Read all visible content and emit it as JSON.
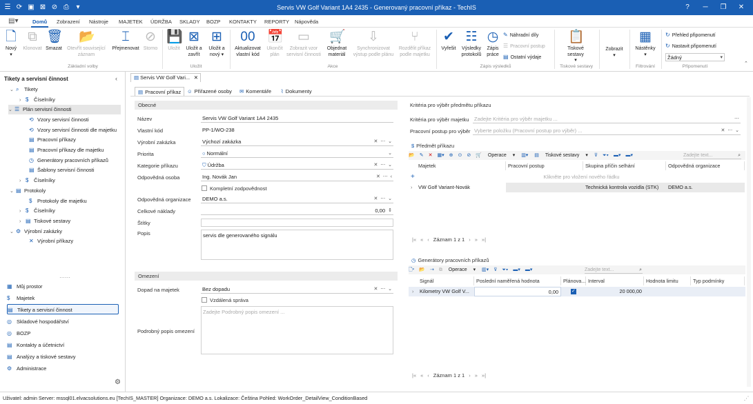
{
  "window": {
    "title": "Servis VW Golf Variant 1A4 2435 - Generovaný pracovní příkaz - TechIS"
  },
  "menu": [
    "Domů",
    "Zobrazení",
    "Nástroje",
    "MAJETEK",
    "ÚDRŽBA",
    "SKLADY",
    "BOZP",
    "KONTAKTY",
    "REPORTY",
    "Nápověda"
  ],
  "ribbon": {
    "new": "Nový",
    "clone": "Klonovat",
    "delete": "Smazat",
    "open_related": "Otevřít související záznam",
    "rename": "Přejmenovat",
    "cancel": "Storno",
    "group_basic": "Základní volby",
    "save": "Uložit",
    "save_close": "Uložit a zavřít",
    "save_new": "Uložit a nový",
    "group_save": "Uložit",
    "update_code": "Aktualizovat vlastní kód",
    "finish_plan": "Ukončit plán",
    "show_template": "Zobrazit vzor servisní činnosti",
    "order_material": "Objednat materiál",
    "sync_output": "Synchronizovat výstup podle plánu",
    "split_order": "Rozdělit příkaz podle majetku",
    "group_actions": "Akce",
    "resolve": "Vyřešit",
    "results": "Výsledky protokolů",
    "record_work": "Zápis práce",
    "spare_parts": "Náhradní díly",
    "work_postup": "Pracovní postup",
    "other_costs": "Ostatní výdaje",
    "group_results": "Zápis výsledků",
    "print_reports": "Tiskové sestavy",
    "group_print": "Tiskové sestavy",
    "show": "Zobrazit",
    "dashboards": "Nástěnky",
    "group_filter": "Filtrování",
    "reminder_overview": "Přehled připomenutí",
    "set_reminder": "Nastavit připomenutí",
    "reminder_value": "Žádný",
    "group_reminders": "Připomenutí"
  },
  "sidebar": {
    "title": "Tikety a servisní činnost",
    "tree": [
      {
        "label": "Tikety",
        "icon": "search-icon"
      },
      {
        "label": "Číselníky",
        "icon": "dollar-icon"
      },
      {
        "label": "Plán servisní činnosti",
        "icon": "list-icon"
      },
      {
        "label": "Vzory servisní činnosti",
        "icon": "refresh-icon"
      },
      {
        "label": "Vzory servisní činnosti dle majetku",
        "icon": "refresh-icon"
      },
      {
        "label": "Pracovní příkazy",
        "icon": "doc-icon"
      },
      {
        "label": "Pracovní příkazy dle majetku",
        "icon": "doc-icon"
      },
      {
        "label": "Generátory pracovních příkazů",
        "icon": "clock-icon"
      },
      {
        "label": "Šablony servisní činnosti",
        "icon": "doc-icon"
      },
      {
        "label": "Číselníky",
        "icon": "dollar-icon"
      },
      {
        "label": "Protokoly",
        "icon": "doc-icon"
      },
      {
        "label": "Protokoly dle majetku",
        "icon": "dollar-icon"
      },
      {
        "label": "Číselníky",
        "icon": "dollar-icon"
      },
      {
        "label": "Tiskové sestavy",
        "icon": "doc-icon"
      },
      {
        "label": "Výrobní zakázky",
        "icon": "gear-icon"
      },
      {
        "label": "Výrobní příkazy",
        "icon": "tool-icon"
      }
    ],
    "nav": [
      "Můj prostor",
      "Majetek",
      "Tikety a servisní činnost",
      "Skladové hospodářství",
      "BOZP",
      "Kontakty a účetnictví",
      "Analýzy a tiskové sestavy",
      "Administrace"
    ]
  },
  "doc_tab": "Servis VW Golf Vari...",
  "subtabs": [
    "Pracovní příkaz",
    "Přiřazené osoby",
    "Komentáře",
    "Dokumenty"
  ],
  "general": {
    "section": "Obecné",
    "name_label": "Název",
    "name_value": "Servis VW Golf Variant 1A4 2435",
    "code_label": "Vlastní kód",
    "code_value": "PP-1/WO-238",
    "order_label": "Výrobní zakázka",
    "order_value": "Výchozí zakázka",
    "priority_label": "Priorita",
    "priority_value": "Normální",
    "category_label": "Kategorie příkazu",
    "category_value": "Údržba",
    "person_label": "Odpovědná osoba",
    "person_value": "Ing. Novák Jan",
    "full_resp_label": "Kompletní zodpovědnost",
    "org_label": "Odpovědná organizace",
    "org_value": "DEMO a.s.",
    "cost_label": "Celkové náklady",
    "cost_value": "0,00",
    "tags_label": "Štítky",
    "desc_label": "Popis",
    "desc_value": "servis dle generovaného signálu"
  },
  "limits": {
    "section": "Omezení",
    "impact_label": "Dopad na majetek",
    "impact_value": "Bez dopadu",
    "remote_label": "Vzdálená správa",
    "detail_label": "Podrobný popis omezení",
    "detail_placeholder": "Zadejte Podrobný popis omezení ..."
  },
  "criteria": {
    "section": "Kritéria pro výběr předmětu příkazu",
    "crit_label": "Kritéria pro výběr majetku",
    "crit_placeholder": "Zadejte Kritéria pro výběr majetku ...",
    "postup_label": "Pracovní postup pro výběr",
    "postup_placeholder": "Vyberte položku (Pracovní postup pro výběr) ..."
  },
  "subject": {
    "header": "Předmět příkazu",
    "ops": "Operace",
    "print": "Tiskové sestavy",
    "search_placeholder": "Zadejte text...",
    "columns": [
      "Majetek",
      "Pracovní postup",
      "Skupina příčin selhání",
      "Odpovědná organizace"
    ],
    "new_row": "Klikněte pro vložení nového řádku",
    "rows": [
      {
        "asset": "VW Golf Variant-Novák",
        "postup": "",
        "group": "Technická kontrola vozidla (STK)",
        "org": "DEMO a.s."
      }
    ],
    "pager": "Záznam 1 z 1"
  },
  "generators": {
    "header": "Generátory pracovních příkazů",
    "ops": "Operace",
    "search_placeholder": "Zadejte text...",
    "columns": [
      "Signál",
      "Poslední naměřená hodnota",
      "Plánova...",
      "Interval",
      "Hodnota limitu",
      "Typ podmínky"
    ],
    "rows": [
      {
        "signal": "Kilometry VW Golf V...",
        "last": "0,00",
        "planned": true,
        "interval": "20 000,00",
        "limit": "",
        "type": ""
      }
    ],
    "pager": "Záznam 1 z 1"
  },
  "status": "Uživatel: admin   Server: mssql01.elvacsolutions.eu [TechIS_MASTER]   Organizace: DEMO a.s.   Lokalizace: Čeština   Pohled: WorkOrder_DetailView_ConditionBased"
}
